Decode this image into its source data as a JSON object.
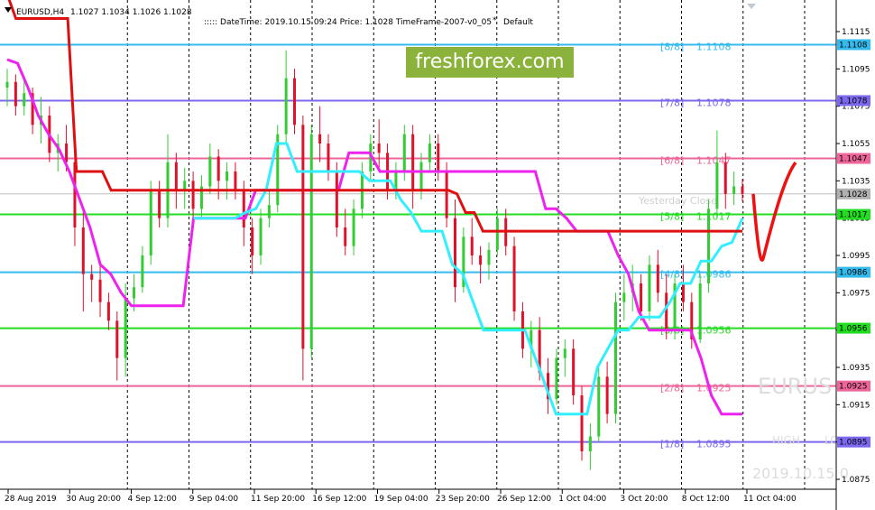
{
  "header": {
    "symbol": "EURUSD,H4",
    "ohlc": "1.1027 1.1034 1.1026 1.1028",
    "info": ":::::  DateTime: 2019.10.15 09:24    Price: 1.1028    TimeFrame-2007-v0_05",
    "template": "Default"
  },
  "brand": {
    "label": "freshforex.com",
    "color": "#8bb33b"
  },
  "watermarks": {
    "symbol": "EURUS",
    "high": "HIGH",
    "low": "LO",
    "datetime": "2019.10.15 0"
  },
  "colors": {
    "bull": "#33cc33",
    "bear": "#e0112b",
    "magenta": "#ee22ee",
    "cyan": "#33eeff",
    "red_line": "#dd1111",
    "forecast": "#ee1111",
    "yesterday_close": "#c0c0c0"
  },
  "chart_data": {
    "type": "candlestick",
    "symbol": "EURUSD",
    "timeframe": "H4",
    "ylim": [
      1.0875,
      1.1125
    ],
    "y_ticks": [
      "1.1115",
      "1.1095",
      "1.1075",
      "1.1055",
      "1.1035",
      "1.1015",
      "1.0995",
      "1.0975",
      "1.0955",
      "1.0935",
      "1.0915",
      "1.0895",
      "1.0875"
    ],
    "x_ticks": [
      "28 Aug 2019",
      "30 Aug 20:00",
      "4 Sep 12:00",
      "9 Sep 04:00",
      "11 Sep 20:00",
      "16 Sep 12:00",
      "19 Sep 04:00",
      "23 Sep 20:00",
      "26 Sep 12:00",
      "1 Oct 04:00",
      "3 Oct 20:00",
      "8 Oct 12:00",
      "11 Oct 04:00"
    ],
    "murrey_levels": [
      {
        "label": "[8/8]",
        "value": 1.1108,
        "color": "#33bbee"
      },
      {
        "label": "[7/8]",
        "value": 1.1078,
        "color": "#7b68ee"
      },
      {
        "label": "[6/8]",
        "value": 1.1047,
        "color": "#ee6699"
      },
      {
        "label": "[5/8]",
        "value": 1.1017,
        "color": "#22dd22"
      },
      {
        "label": "[4/8]",
        "value": 1.0986,
        "color": "#33bbee"
      },
      {
        "label": "[3/8]",
        "value": 1.0956,
        "color": "#22dd22"
      },
      {
        "label": "[2/8]",
        "value": 1.0925,
        "color": "#ee6699"
      },
      {
        "label": "[1/8]",
        "value": 1.0895,
        "color": "#7b68ee"
      }
    ],
    "level_texts": {
      "1.1108": "1.1108",
      "1.1078": "1.1078",
      "1.1047": "1.1047",
      "1.1017": "1.1017",
      "1.0986": "1.0986",
      "1.0956": "1.0956",
      "1.0925": "1.0925",
      "1.0895": "1.0895"
    },
    "yesterday_close_label": "Yesterday Close",
    "current_price": 1.1028,
    "candles": [
      [
        1.1085,
        1.1095,
        1.1075,
        1.1088
      ],
      [
        1.1088,
        1.1092,
        1.107,
        1.1075
      ],
      [
        1.1075,
        1.109,
        1.107,
        1.1082
      ],
      [
        1.1082,
        1.1085,
        1.106,
        1.1065
      ],
      [
        1.1065,
        1.108,
        1.1055,
        1.107
      ],
      [
        1.107,
        1.1075,
        1.1045,
        1.105
      ],
      [
        1.105,
        1.106,
        1.104,
        1.1055
      ],
      [
        1.1055,
        1.1065,
        1.104,
        1.1045
      ],
      [
        1.1045,
        1.105,
        1.1,
        1.101
      ],
      [
        1.101,
        1.102,
        1.0965,
        1.0985
      ],
      [
        1.0985,
        1.099,
        1.097,
        1.0982
      ],
      [
        1.0982,
        1.099,
        1.0962,
        1.097
      ],
      [
        1.097,
        1.0975,
        1.0955,
        1.096
      ],
      [
        1.096,
        1.0965,
        1.0928,
        1.094
      ],
      [
        1.094,
        1.098,
        1.093,
        1.0972
      ],
      [
        1.0972,
        1.0985,
        1.0965,
        1.0978
      ],
      [
        1.0978,
        1.1,
        1.0975,
        1.0995
      ],
      [
        1.0995,
        1.1035,
        1.099,
        1.103
      ],
      [
        1.103,
        1.1035,
        1.101,
        1.1015
      ],
      [
        1.1015,
        1.106,
        1.101,
        1.1045
      ],
      [
        1.1045,
        1.105,
        1.102,
        1.103
      ],
      [
        1.103,
        1.1042,
        1.102,
        1.1035
      ],
      [
        1.1035,
        1.104,
        1.1015,
        1.102
      ],
      [
        1.102,
        1.1038,
        1.1015,
        1.1032
      ],
      [
        1.1032,
        1.1055,
        1.1028,
        1.1048
      ],
      [
        1.1048,
        1.1052,
        1.1025,
        1.1035
      ],
      [
        1.1035,
        1.1045,
        1.1025,
        1.104
      ],
      [
        1.104,
        1.1045,
        1.1025,
        1.103
      ],
      [
        1.103,
        1.1035,
        1.1,
        1.101
      ],
      [
        1.101,
        1.1015,
        1.0985,
        1.0995
      ],
      [
        1.0995,
        1.102,
        1.099,
        1.1015
      ],
      [
        1.1015,
        1.103,
        1.101,
        1.1022
      ],
      [
        1.1022,
        1.1065,
        1.1018,
        1.106
      ],
      [
        1.106,
        1.1105,
        1.1055,
        1.109
      ],
      [
        1.109,
        1.1095,
        1.106,
        1.1065
      ],
      [
        1.1065,
        1.107,
        1.0928,
        1.0945
      ],
      [
        1.0945,
        1.1065,
        1.094,
        1.106
      ],
      [
        1.106,
        1.1075,
        1.1045,
        1.1055
      ],
      [
        1.1055,
        1.106,
        1.1035,
        1.104
      ],
      [
        1.104,
        1.1045,
        1.1005,
        1.101
      ],
      [
        1.101,
        1.102,
        1.0995,
        1.1
      ],
      [
        1.1,
        1.1025,
        1.0995,
        1.102
      ],
      [
        1.102,
        1.1045,
        1.1015,
        1.104
      ],
      [
        1.104,
        1.106,
        1.1035,
        1.1055
      ],
      [
        1.1055,
        1.1068,
        1.104,
        1.105
      ],
      [
        1.105,
        1.1055,
        1.1025,
        1.103
      ],
      [
        1.103,
        1.1045,
        1.1025,
        1.104
      ],
      [
        1.104,
        1.1065,
        1.1035,
        1.106
      ],
      [
        1.106,
        1.1065,
        1.102,
        1.103
      ],
      [
        1.103,
        1.105,
        1.1025,
        1.1045
      ],
      [
        1.1045,
        1.106,
        1.104,
        1.1055
      ],
      [
        1.1055,
        1.106,
        1.1035,
        1.104
      ],
      [
        1.104,
        1.1045,
        1.101,
        1.1015
      ],
      [
        1.1015,
        1.1025,
        1.097,
        1.0978
      ],
      [
        1.0978,
        1.101,
        1.0975,
        1.1005
      ],
      [
        1.1005,
        1.1015,
        1.099,
        1.0995
      ],
      [
        1.0995,
        1.1,
        1.098,
        1.099
      ],
      [
        1.099,
        1.1002,
        1.0982,
        1.0998
      ],
      [
        1.0998,
        1.102,
        1.0995,
        1.1015
      ],
      [
        1.1015,
        1.102,
        1.0995,
        1.1
      ],
      [
        1.1,
        1.1005,
        1.096,
        1.0965
      ],
      [
        1.0965,
        1.097,
        1.094,
        1.0945
      ],
      [
        1.0945,
        1.096,
        1.0935,
        1.0955
      ],
      [
        1.0955,
        1.0962,
        1.0928,
        1.0932
      ],
      [
        1.0932,
        1.094,
        1.091,
        1.0918
      ],
      [
        1.0918,
        1.0945,
        1.0915,
        1.094
      ],
      [
        1.094,
        1.095,
        1.093,
        1.0945
      ],
      [
        1.0945,
        1.095,
        1.0915,
        1.092
      ],
      [
        1.092,
        1.0925,
        1.0885,
        1.089
      ],
      [
        1.089,
        1.0905,
        1.088,
        1.0898
      ],
      [
        1.0898,
        1.0935,
        1.0895,
        1.093
      ],
      [
        1.093,
        1.0938,
        1.0905,
        1.091
      ],
      [
        1.091,
        1.0975,
        1.0905,
        1.097
      ],
      [
        1.097,
        1.0985,
        1.096,
        1.0975
      ],
      [
        1.0975,
        1.099,
        1.0965,
        1.098
      ],
      [
        1.098,
        1.0985,
        1.096,
        1.0965
      ],
      [
        1.0965,
        1.0995,
        1.096,
        1.099
      ],
      [
        1.099,
        1.0998,
        1.097,
        1.0975
      ],
      [
        1.0975,
        1.0985,
        1.095,
        1.0955
      ],
      [
        1.0955,
        1.0985,
        1.095,
        1.098
      ],
      [
        1.098,
        1.099,
        1.0965,
        1.097
      ],
      [
        1.097,
        1.0975,
        1.0945,
        1.095
      ],
      [
        1.095,
        1.0985,
        1.0948,
        1.098
      ],
      [
        1.098,
        1.1025,
        1.0975,
        1.102
      ],
      [
        1.102,
        1.1062,
        1.1015,
        1.1045
      ],
      [
        1.1045,
        1.105,
        1.102,
        1.1028
      ],
      [
        1.1028,
        1.104,
        1.1022,
        1.1032
      ],
      [
        1.1032,
        1.1036,
        1.1024,
        1.1028
      ]
    ],
    "series": [
      {
        "name": "",
        "color": "#ee22ee",
        "values": [
          1.11,
          1.1098,
          1.1085,
          1.107,
          1.106,
          1.1052,
          1.104,
          1.1025,
          1.101,
          1.099,
          1.0985,
          1.0975,
          1.0968,
          1.0968,
          1.0968,
          1.0968,
          1.0968,
          1.0968,
          1.1015,
          1.1015,
          1.1015,
          1.1015,
          1.1015,
          1.1015,
          1.103,
          1.103,
          1.103,
          1.103,
          1.103,
          1.103,
          1.103,
          1.103,
          1.103,
          1.105,
          1.105,
          1.105,
          1.104,
          1.104,
          1.104,
          1.104,
          1.104,
          1.104,
          1.104,
          1.104,
          1.104,
          1.104,
          1.104,
          1.104,
          1.104,
          1.104,
          1.104,
          1.104,
          1.102,
          1.102,
          1.1015,
          1.1008,
          1.1008,
          1.1008,
          1.1008,
          1.0995,
          1.0985,
          1.0965,
          1.0955,
          1.0955,
          1.0955,
          1.0955,
          1.0955,
          1.094,
          1.092,
          1.091,
          1.091,
          1.091
        ]
      },
      {
        "name": "",
        "color": "#33eeff",
        "values": [
          null,
          null,
          null,
          null,
          null,
          null,
          null,
          null,
          null,
          null,
          null,
          null,
          null,
          null,
          null,
          null,
          null,
          null,
          1.1015,
          1.1015,
          1.1015,
          1.1015,
          1.1015,
          1.1018,
          1.102,
          1.103,
          1.1055,
          1.1055,
          1.104,
          1.104,
          1.104,
          1.104,
          1.104,
          1.104,
          1.104,
          1.1035,
          1.1035,
          1.1035,
          1.1025,
          1.1018,
          1.1008,
          1.1008,
          1.1008,
          1.099,
          1.0985,
          1.097,
          1.0955,
          1.0955,
          1.0955,
          1.0955,
          1.0955,
          1.094,
          1.0925,
          1.091,
          1.091,
          1.091,
          1.091,
          1.0935,
          1.0945,
          1.0955,
          1.0955,
          1.0962,
          1.0962,
          1.0962,
          1.097,
          1.098,
          1.098,
          1.0992,
          1.0992,
          1.1,
          1.1002,
          1.1015
        ]
      },
      {
        "name": "",
        "color": "#dd1111",
        "values": [
          1.1135,
          1.1122,
          1.1122,
          1.1122,
          1.1122,
          1.1122,
          1.1122,
          1.1122,
          1.104,
          1.104,
          1.104,
          1.104,
          1.103,
          1.103,
          1.103,
          1.103,
          1.103,
          1.103,
          1.103,
          1.103,
          1.103,
          1.103,
          1.103,
          1.103,
          1.103,
          1.103,
          1.103,
          1.103,
          1.103,
          1.103,
          1.103,
          1.103,
          1.103,
          1.103,
          1.103,
          1.103,
          1.103,
          1.103,
          1.103,
          1.103,
          1.103,
          1.103,
          1.103,
          1.103,
          1.103,
          1.103,
          1.103,
          1.103,
          1.103,
          1.103,
          1.103,
          1.103,
          1.1028,
          1.1018,
          1.1018,
          1.1008,
          1.1008,
          1.1008,
          1.1008,
          1.1008,
          1.1008,
          1.1008,
          1.1008,
          1.1008,
          1.1008,
          1.1008,
          1.1008,
          1.1008,
          1.1008,
          1.1008,
          1.1008,
          1.1008,
          1.1008,
          1.1008,
          1.1008,
          1.1008,
          1.1008,
          1.1008,
          1.1008,
          1.1008,
          1.1008,
          1.1008,
          1.1008,
          1.1008,
          1.1008,
          1.1008
        ]
      }
    ],
    "forecast": {
      "name": "",
      "values": [
        1.1028,
        1.1005,
        1.1008,
        1.1035,
        1.104
      ]
    }
  }
}
